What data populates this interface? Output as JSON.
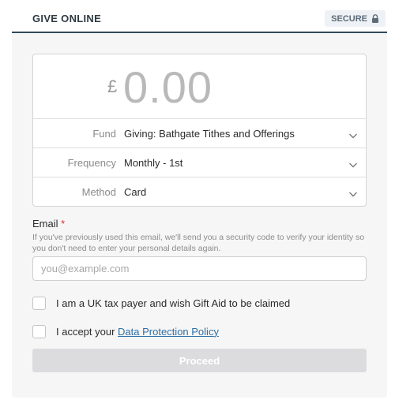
{
  "header": {
    "title": "GIVE ONLINE",
    "secure_label": "SECURE",
    "secure_icon": "lock-icon"
  },
  "amount": {
    "currency": "£",
    "value": "0.00"
  },
  "fields": [
    {
      "label": "Fund",
      "value": "Giving: Bathgate Tithes and Offerings"
    },
    {
      "label": "Frequency",
      "value": "Monthly - 1st"
    },
    {
      "label": "Method",
      "value": "Card"
    }
  ],
  "email": {
    "label": "Email",
    "required_marker": "*",
    "help": "If you've previously used this email, we'll send you a security code to verify your identity so you don't need to enter your personal details again.",
    "placeholder": "you@example.com",
    "value": ""
  },
  "gift_aid": {
    "label": "I am a UK tax payer and wish Gift Aid to be claimed",
    "checked": false
  },
  "data_protection": {
    "prefix": "I accept your ",
    "link_text": "Data Protection Policy",
    "checked": false
  },
  "proceed_label": "Proceed",
  "colors": {
    "header_rule": "#2f4a5a",
    "link": "#2f6fa5",
    "required": "#d0342c",
    "proceed_disabled": "#dcdcdf"
  }
}
